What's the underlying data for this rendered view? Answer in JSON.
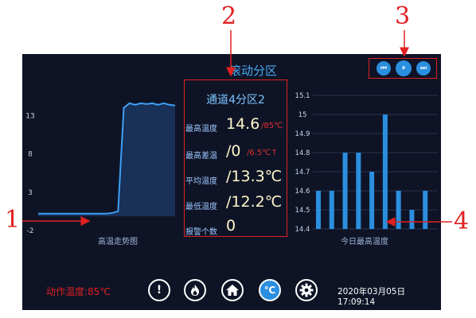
{
  "screen": {
    "title": "滚动分区"
  },
  "media": {
    "prev_icon": "skip-previous-icon",
    "pause_icon": "pause-icon",
    "next_icon": "skip-next-icon"
  },
  "left_chart": {
    "label": "高温走势图",
    "yticks": [
      "13",
      "8",
      "3",
      "-2"
    ]
  },
  "info": {
    "title": "通道4分区2",
    "max_temp": {
      "label": "最高温度",
      "value": "14.6",
      "sub": "/85℃"
    },
    "max_diff": {
      "label": "最高差温",
      "value": "/0",
      "sub": "/6.5℃↑"
    },
    "avg_temp": {
      "label": "平均温度",
      "value": "/13.3℃"
    },
    "min_temp": {
      "label": "最低温度",
      "value": "/12.2℃"
    },
    "alarms": {
      "label": "报警个数",
      "value": "0"
    }
  },
  "right_chart": {
    "label": "今日最高温度",
    "yticks": [
      "15.1",
      "15",
      "14.9",
      "14.8",
      "14.7",
      "14.6",
      "14.5",
      "14.4"
    ]
  },
  "chart_data": [
    {
      "type": "area",
      "title": "",
      "xlabel": "高温走势图",
      "ylabel": "",
      "ylim": [
        -2,
        15
      ],
      "x": [
        0,
        1,
        2,
        3,
        4,
        5,
        6,
        7,
        8,
        9,
        10,
        11,
        12,
        13,
        14,
        15,
        16,
        17,
        18,
        19,
        20,
        21,
        22,
        23,
        24
      ],
      "values": [
        0.2,
        0.2,
        0.2,
        0.2,
        0.2,
        0.2,
        0.2,
        0.2,
        0.2,
        0.2,
        0.2,
        0.2,
        0.2,
        0.3,
        0.5,
        14.0,
        14.6,
        14.4,
        14.6,
        14.5,
        14.6,
        14.4,
        14.6,
        14.4,
        14.3
      ]
    },
    {
      "type": "bar",
      "title": "",
      "xlabel": "今日最高温度",
      "ylabel": "",
      "ylim": [
        14.4,
        15.1
      ],
      "categories": [
        "1",
        "2",
        "3",
        "4",
        "5",
        "6",
        "7",
        "8",
        "9"
      ],
      "values": [
        14.6,
        14.6,
        14.8,
        14.8,
        14.7,
        15.0,
        14.6,
        14.5,
        14.6
      ]
    }
  ],
  "footer": {
    "action_temp": "动作温度:85℃",
    "datetime": "2020年03月05日 17:09:14",
    "btn_alarm": "!",
    "btn_celsius": "℃"
  },
  "annotations": {
    "a1": "1",
    "a2": "2",
    "a3": "3",
    "a4": "4"
  },
  "colors": {
    "accent": "#2b8fe0",
    "background": "#0e1426",
    "annotation": "#e02020"
  }
}
